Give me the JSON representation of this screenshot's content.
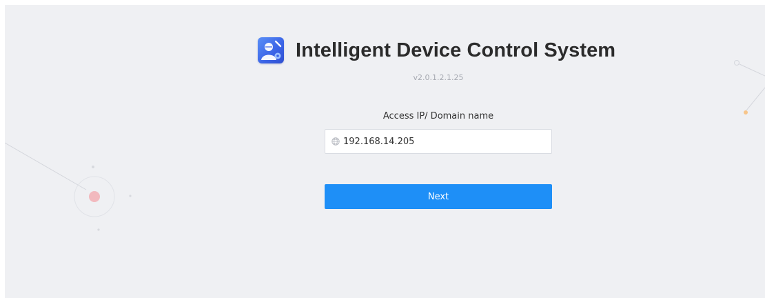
{
  "app": {
    "title": "Intelligent Device Control System",
    "version": "v2.0.1.2.1.25",
    "logo_icon": "user-settings-icon"
  },
  "login": {
    "field_label": "Access IP/ Domain name",
    "field_value": "192.168.14.205",
    "field_icon": "globe-icon",
    "next_label": "Next"
  },
  "colors": {
    "background": "#eff0f3",
    "accent": "#1e8ff7",
    "logo_blue": "#3a63e6",
    "decor_red": "#f2b9be",
    "decor_orange": "#f7c58a"
  }
}
